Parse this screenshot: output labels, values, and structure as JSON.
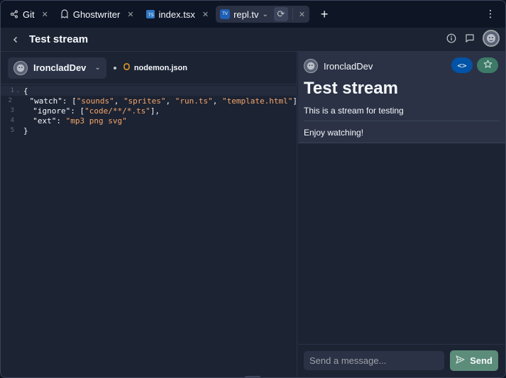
{
  "tabs": [
    {
      "label": "Git",
      "icon": "git-branch-icon"
    },
    {
      "label": "Ghostwriter",
      "icon": "ghostwriter-icon"
    },
    {
      "label": "index.tsx",
      "icon": "typescript-file-icon"
    },
    {
      "label": "repl.tv",
      "icon": "repl-tv-icon",
      "active": true
    }
  ],
  "header": {
    "title": "Test stream"
  },
  "editor": {
    "user": "IroncladDev",
    "file": "nodemon.json",
    "lines": [
      {
        "n": "1",
        "parts": [
          [
            "k",
            "{"
          ]
        ]
      },
      {
        "n": "2",
        "parts": [
          [
            "k",
            "  \"watch\": ["
          ],
          [
            "s",
            "\"sounds\""
          ],
          [
            "k",
            ", "
          ],
          [
            "s",
            "\"sprites\""
          ],
          [
            "k",
            ", "
          ],
          [
            "s",
            "\"run.ts\""
          ],
          [
            "k",
            ", "
          ],
          [
            "s",
            "\"template.html\""
          ],
          [
            "k",
            "]"
          ]
        ]
      },
      {
        "n": "3",
        "parts": [
          [
            "k",
            "  \"ignore\": ["
          ],
          [
            "s",
            "\"code/**/*.ts\""
          ],
          [
            "k",
            "],"
          ]
        ]
      },
      {
        "n": "4",
        "parts": [
          [
            "k",
            "  \"ext\": "
          ],
          [
            "s",
            "\"mp3 png svg\""
          ]
        ]
      },
      {
        "n": "5",
        "parts": [
          [
            "k",
            "}"
          ]
        ]
      }
    ]
  },
  "stream": {
    "user": "IroncladDev",
    "title": "Test stream",
    "description": "This is a stream for testing",
    "message": "Enjoy watching!",
    "code_label": "<>"
  },
  "chat": {
    "placeholder": "Send a message...",
    "send_label": "Send"
  },
  "colors": {
    "accent_blue": "#0053a6",
    "accent_green": "#5c8c7a",
    "string": "#f5a669",
    "background": "#1c2333"
  }
}
